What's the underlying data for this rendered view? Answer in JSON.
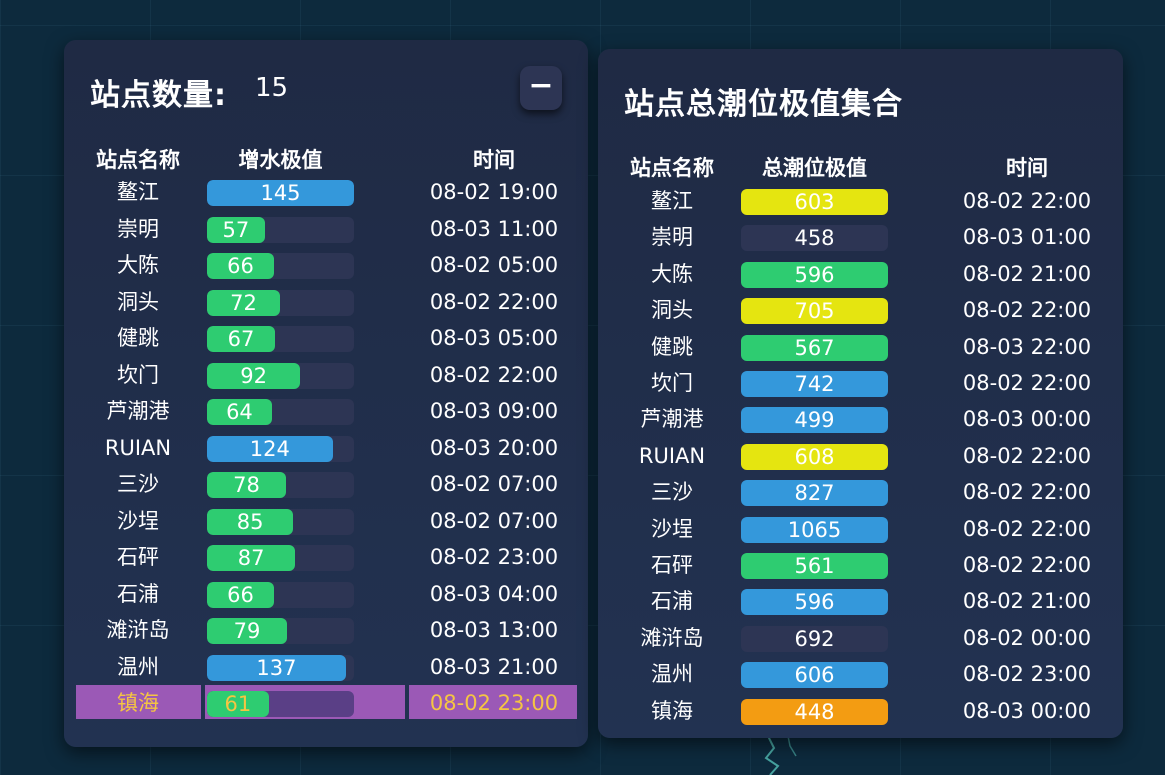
{
  "left_panel": {
    "count_label": "站点数量:",
    "count_value": "15",
    "collapse_label": "−",
    "headers": {
      "name": "站点名称",
      "value": "增水极值",
      "time": "时间"
    },
    "max_value": 145,
    "rows": [
      {
        "name": "鳌江",
        "value": 145,
        "time": "08-02 19:00",
        "color": "#3498db"
      },
      {
        "name": "崇明",
        "value": 57,
        "time": "08-03 11:00",
        "color": "#2ecc71"
      },
      {
        "name": "大陈",
        "value": 66,
        "time": "08-02 05:00",
        "color": "#2ecc71"
      },
      {
        "name": "洞头",
        "value": 72,
        "time": "08-02 22:00",
        "color": "#2ecc71"
      },
      {
        "name": "健跳",
        "value": 67,
        "time": "08-03 05:00",
        "color": "#2ecc71"
      },
      {
        "name": "坎门",
        "value": 92,
        "time": "08-02 22:00",
        "color": "#2ecc71"
      },
      {
        "name": "芦潮港",
        "value": 64,
        "time": "08-03 09:00",
        "color": "#2ecc71"
      },
      {
        "name": "RUIAN",
        "value": 124,
        "time": "08-03 20:00",
        "color": "#3498db"
      },
      {
        "name": "三沙",
        "value": 78,
        "time": "08-02 07:00",
        "color": "#2ecc71"
      },
      {
        "name": "沙埕",
        "value": 85,
        "time": "08-02 07:00",
        "color": "#2ecc71"
      },
      {
        "name": "石砰",
        "value": 87,
        "time": "08-02 23:00",
        "color": "#2ecc71"
      },
      {
        "name": "石浦",
        "value": 66,
        "time": "08-03 04:00",
        "color": "#2ecc71"
      },
      {
        "name": "滩浒岛",
        "value": 79,
        "time": "08-03 13:00",
        "color": "#2ecc71"
      },
      {
        "name": "温州",
        "value": 137,
        "time": "08-03 21:00",
        "color": "#3498db"
      },
      {
        "name": "镇海",
        "value": 61,
        "time": "08-02 23:00",
        "color": "#2ecc71",
        "highlight": true
      }
    ]
  },
  "right_panel": {
    "title": "站点总潮位极值集合",
    "headers": {
      "name": "站点名称",
      "value": "总潮位极值",
      "time": "时间"
    },
    "rows": [
      {
        "name": "鳌江",
        "value": 603,
        "time": "08-02 22:00",
        "color": "#e5e510"
      },
      {
        "name": "崇明",
        "value": 458,
        "time": "08-03 01:00",
        "color": "#2d3554"
      },
      {
        "name": "大陈",
        "value": 596,
        "time": "08-02 21:00",
        "color": "#2ecc71"
      },
      {
        "name": "洞头",
        "value": 705,
        "time": "08-02 22:00",
        "color": "#e5e510"
      },
      {
        "name": "健跳",
        "value": 567,
        "time": "08-03 22:00",
        "color": "#2ecc71"
      },
      {
        "name": "坎门",
        "value": 742,
        "time": "08-02 22:00",
        "color": "#3498db"
      },
      {
        "name": "芦潮港",
        "value": 499,
        "time": "08-03 00:00",
        "color": "#3498db"
      },
      {
        "name": "RUIAN",
        "value": 608,
        "time": "08-02 22:00",
        "color": "#e5e510"
      },
      {
        "name": "三沙",
        "value": 827,
        "time": "08-02 22:00",
        "color": "#3498db"
      },
      {
        "name": "沙埕",
        "value": 1065,
        "time": "08-02 22:00",
        "color": "#3498db"
      },
      {
        "name": "石砰",
        "value": 561,
        "time": "08-02 22:00",
        "color": "#2ecc71"
      },
      {
        "name": "石浦",
        "value": 596,
        "time": "08-02 21:00",
        "color": "#3498db"
      },
      {
        "name": "滩浒岛",
        "value": 692,
        "time": "08-02 00:00",
        "color": "#2d3554"
      },
      {
        "name": "温州",
        "value": 606,
        "time": "08-02 23:00",
        "color": "#3498db"
      },
      {
        "name": "镇海",
        "value": 448,
        "time": "08-03 00:00",
        "color": "#f39c12"
      }
    ]
  }
}
